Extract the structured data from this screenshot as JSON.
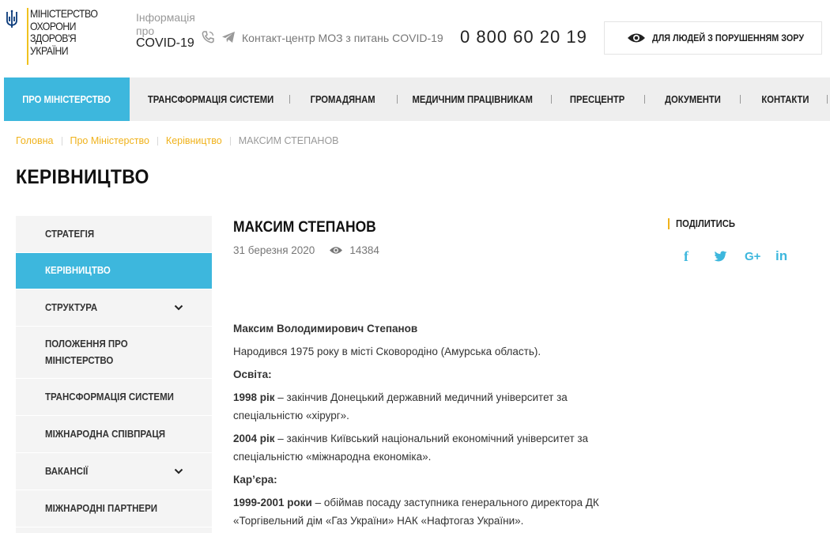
{
  "header": {
    "logo_lines": [
      "Міністерство",
      "охорони",
      "здоров'я",
      "України"
    ],
    "covid_info": [
      "Інформація",
      "про",
      "COVID-19"
    ],
    "contact_text": "Контакт-центр МОЗ з питань COVID-19",
    "hotline": "0 800 60 20 19",
    "vision_button": "Для людей з порушенням зору"
  },
  "nav": {
    "items": [
      {
        "label": "Про Міністерство",
        "active": true
      },
      {
        "label": "Трансформація системи"
      },
      {
        "label": "Громадянам"
      },
      {
        "label": "Медичним працівникам"
      },
      {
        "label": "Пресцентр"
      },
      {
        "label": "Документи"
      },
      {
        "label": "Контакти"
      }
    ]
  },
  "breadcrumb": {
    "items": [
      "Головна",
      "Про Міністерство",
      "Керівництво"
    ],
    "current": "МАКСИМ СТЕПАНОВ"
  },
  "page_title": "Керівництво",
  "sidebar": {
    "items": [
      {
        "label": "Стратегія"
      },
      {
        "label": "Керівництво",
        "active": true
      },
      {
        "label": "Структура",
        "has_children": true
      },
      {
        "label": "Положення про Міністерство"
      },
      {
        "label": "Трансформація системи"
      },
      {
        "label": "Міжнародна співпраця"
      },
      {
        "label": "Вакансії",
        "has_children": true
      },
      {
        "label": "Міжнародні партнери"
      }
    ]
  },
  "article": {
    "title": "Максим Степанов",
    "date": "31 березня 2020",
    "views": "14384",
    "full_name": "Максим Володимирович Степанов",
    "birth": "Народився 1975 року в місті Сковородіно (Амурська область).",
    "education_heading": "Освіта:",
    "education": [
      {
        "year": "1998 рік",
        "text": " – закінчив Донецький державний медичний університет за спеціальністю «хірург»."
      },
      {
        "year": "2004 рік",
        "text": " – закінчив Київський національний економічний університет за спеціальністю «міжнародна економіка»."
      }
    ],
    "career_heading": "Кар’єра:",
    "career": [
      {
        "year": "1999-2001 роки",
        "text": " – обіймав посаду заступника генерального директора ДК «Торгівельний дім «Газ України» НАК «Нафтогаз України»."
      }
    ]
  },
  "share": {
    "title": "Поділитись",
    "networks": [
      {
        "name": "facebook",
        "glyph": "f"
      },
      {
        "name": "twitter",
        "glyph": "t"
      },
      {
        "name": "google-plus",
        "glyph": "G+"
      },
      {
        "name": "linkedin",
        "glyph": "in"
      }
    ]
  },
  "colors": {
    "accent_blue": "#3db7dd",
    "accent_yellow": "#f0b21b",
    "nav_bg": "#eeeeee",
    "sidebar_bg": "#f4f4f4"
  }
}
